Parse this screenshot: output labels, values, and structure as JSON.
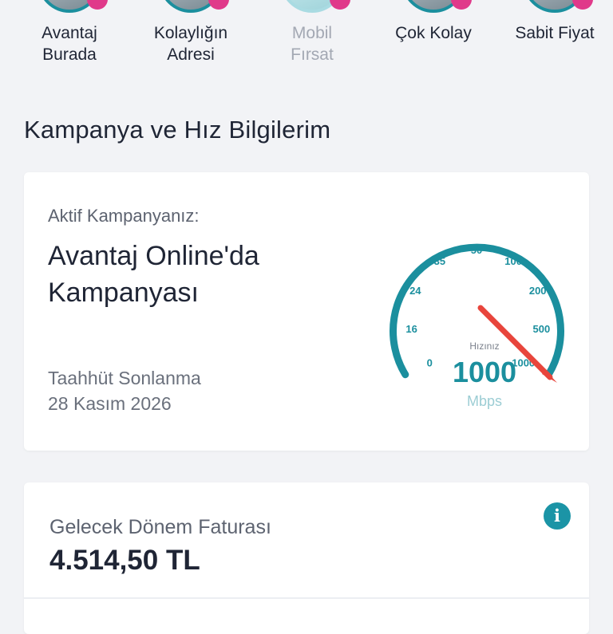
{
  "stories": [
    {
      "label": "Avantaj\nBurada",
      "active": true
    },
    {
      "label": "Kolaylığın\nAdresi",
      "active": true
    },
    {
      "label": "Mobil\nFırsat",
      "active": false
    },
    {
      "label": "Çok Kolay",
      "active": true
    },
    {
      "label": "Sabit Fiyat",
      "active": true
    }
  ],
  "section": {
    "title": "Kampanya ve Hız Bilgilerim"
  },
  "campaign": {
    "label": "Aktif Kampanyanız:",
    "name": "Avantaj Online'da Kampanyası",
    "commitment_label": "Taahhüt Sonlanma",
    "commitment_date": "28 Kasım 2026"
  },
  "speed": {
    "caption": "Hızınız",
    "value": "1000",
    "unit": "Mbps",
    "ticks": [
      "0",
      "16",
      "24",
      "35",
      "50",
      "100",
      "200",
      "500",
      "1000"
    ],
    "accent_color": "#1b8f9e",
    "needle_color": "#e8453c"
  },
  "bill": {
    "label": "Gelecek Dönem Faturası",
    "amount": "4.514,50 TL",
    "info_icon": "info-icon"
  }
}
